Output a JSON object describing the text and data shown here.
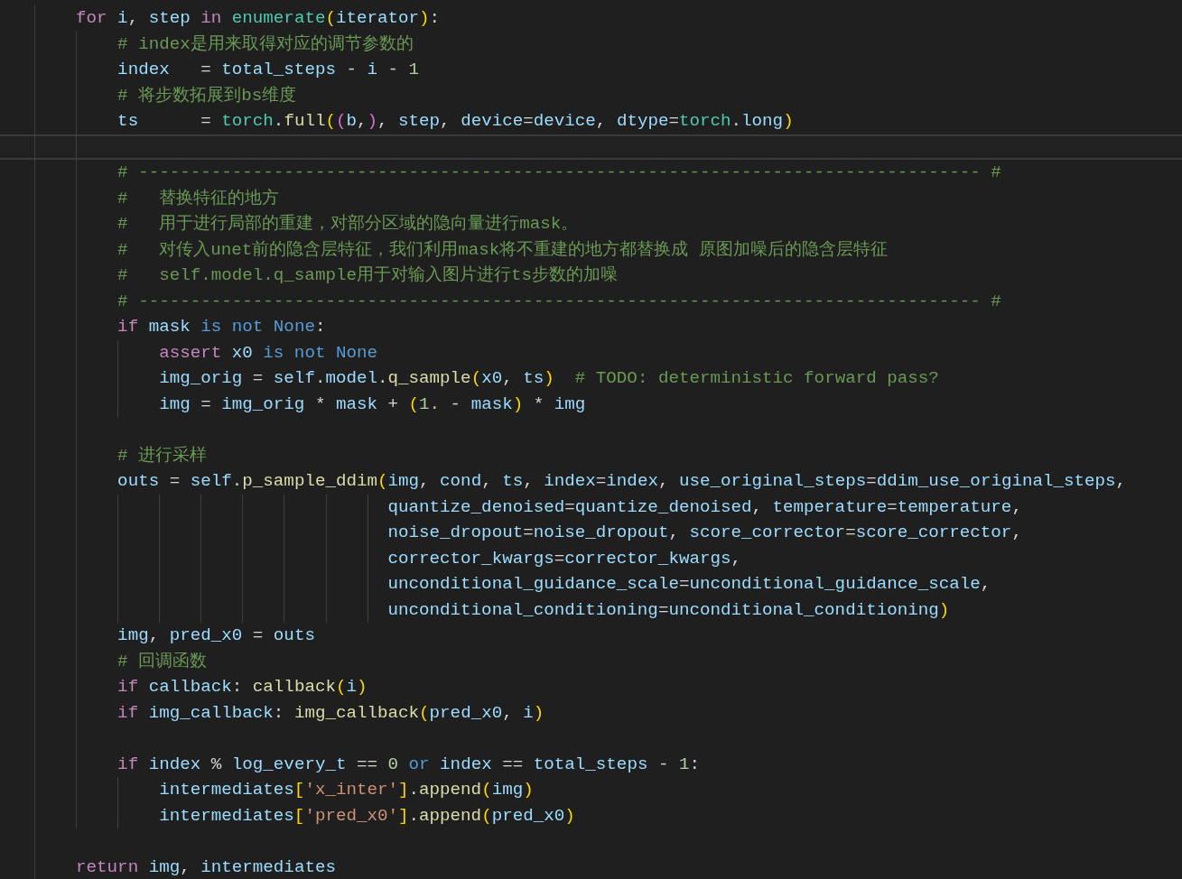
{
  "editor": {
    "lines": [
      {
        "current": false,
        "tokens": [
          {
            "text": "    for",
            "kind": "keyword"
          },
          {
            "text": " i",
            "kind": "variable"
          },
          {
            "text": ", ",
            "kind": "plain"
          },
          {
            "text": "step ",
            "kind": "variable"
          },
          {
            "text": "in ",
            "kind": "keyword"
          },
          {
            "text": "enumerate",
            "kind": "type"
          },
          {
            "text": "(",
            "kind": "bracket1"
          },
          {
            "text": "iterator",
            "kind": "variable"
          },
          {
            "text": ")",
            "kind": "bracket1"
          },
          {
            "text": ":",
            "kind": "plain"
          }
        ]
      },
      {
        "current": false,
        "tokens": [
          {
            "text": "        # index是用来取得对应的调节参数的",
            "kind": "comment"
          }
        ]
      },
      {
        "current": false,
        "tokens": [
          {
            "text": "        index",
            "kind": "variable"
          },
          {
            "text": "   = ",
            "kind": "plain"
          },
          {
            "text": "total_steps",
            "kind": "variable"
          },
          {
            "text": " - ",
            "kind": "plain"
          },
          {
            "text": "i",
            "kind": "variable"
          },
          {
            "text": " - ",
            "kind": "plain"
          },
          {
            "text": "1",
            "kind": "number"
          }
        ]
      },
      {
        "current": false,
        "tokens": [
          {
            "text": "        # 将步数拓展到bs维度",
            "kind": "comment"
          }
        ]
      },
      {
        "current": false,
        "tokens": [
          {
            "text": "        ts",
            "kind": "variable"
          },
          {
            "text": "      = ",
            "kind": "plain"
          },
          {
            "text": "torch",
            "kind": "type"
          },
          {
            "text": ".",
            "kind": "plain"
          },
          {
            "text": "full",
            "kind": "function"
          },
          {
            "text": "(",
            "kind": "bracket1"
          },
          {
            "text": "(",
            "kind": "bracket2"
          },
          {
            "text": "b",
            "kind": "variable"
          },
          {
            "text": ",",
            "kind": "plain"
          },
          {
            "text": ")",
            "kind": "bracket2"
          },
          {
            "text": ", ",
            "kind": "plain"
          },
          {
            "text": "step",
            "kind": "variable"
          },
          {
            "text": ", ",
            "kind": "plain"
          },
          {
            "text": "device",
            "kind": "variable"
          },
          {
            "text": "=",
            "kind": "plain"
          },
          {
            "text": "device",
            "kind": "variable"
          },
          {
            "text": ", ",
            "kind": "plain"
          },
          {
            "text": "dtype",
            "kind": "variable"
          },
          {
            "text": "=",
            "kind": "plain"
          },
          {
            "text": "torch",
            "kind": "type"
          },
          {
            "text": ".",
            "kind": "plain"
          },
          {
            "text": "long",
            "kind": "variable"
          },
          {
            "text": ")",
            "kind": "bracket1"
          }
        ]
      },
      {
        "current": true
      },
      {
        "current": false,
        "tokens": [
          {
            "text": "        # --------------------------------------------------------------------------------- #",
            "kind": "comment"
          }
        ]
      },
      {
        "current": false,
        "tokens": [
          {
            "text": "        #   替换特征的地方",
            "kind": "comment"
          }
        ]
      },
      {
        "current": false,
        "tokens": [
          {
            "text": "        #   用于进行局部的重建，对部分区域的隐向量进行mask。",
            "kind": "comment"
          }
        ]
      },
      {
        "current": false,
        "tokens": [
          {
            "text": "        #   对传入unet前的隐含层特征，我们利用mask将不重建的地方都替换成 原图加噪后的隐含层特征",
            "kind": "comment"
          }
        ]
      },
      {
        "current": false,
        "tokens": [
          {
            "text": "        #   self.model.q_sample用于对输入图片进行ts步数的加噪",
            "kind": "comment"
          }
        ]
      },
      {
        "current": false,
        "tokens": [
          {
            "text": "        # --------------------------------------------------------------------------------- #",
            "kind": "comment"
          }
        ]
      },
      {
        "current": false,
        "tokens": [
          {
            "text": "        if ",
            "kind": "keyword"
          },
          {
            "text": "mask ",
            "kind": "variable"
          },
          {
            "text": "is not None",
            "kind": "keyword2"
          },
          {
            "text": ":",
            "kind": "plain"
          }
        ]
      },
      {
        "current": false,
        "tokens": [
          {
            "text": "            assert ",
            "kind": "keyword"
          },
          {
            "text": "x0 ",
            "kind": "variable"
          },
          {
            "text": "is not None",
            "kind": "keyword2"
          }
        ]
      },
      {
        "current": false,
        "tokens": [
          {
            "text": "            img_orig",
            "kind": "variable"
          },
          {
            "text": " = ",
            "kind": "plain"
          },
          {
            "text": "self",
            "kind": "variable"
          },
          {
            "text": ".",
            "kind": "plain"
          },
          {
            "text": "model",
            "kind": "variable"
          },
          {
            "text": ".",
            "kind": "plain"
          },
          {
            "text": "q_sample",
            "kind": "function"
          },
          {
            "text": "(",
            "kind": "bracket1"
          },
          {
            "text": "x0",
            "kind": "variable"
          },
          {
            "text": ", ",
            "kind": "plain"
          },
          {
            "text": "ts",
            "kind": "variable"
          },
          {
            "text": ")",
            "kind": "bracket1"
          },
          {
            "text": "  # TODO: deterministic forward pass?",
            "kind": "comment"
          }
        ]
      },
      {
        "current": false,
        "tokens": [
          {
            "text": "            img",
            "kind": "variable"
          },
          {
            "text": " = ",
            "kind": "plain"
          },
          {
            "text": "img_orig",
            "kind": "variable"
          },
          {
            "text": " * ",
            "kind": "plain"
          },
          {
            "text": "mask",
            "kind": "variable"
          },
          {
            "text": " + ",
            "kind": "plain"
          },
          {
            "text": "(",
            "kind": "bracket1"
          },
          {
            "text": "1.",
            "kind": "number"
          },
          {
            "text": " - ",
            "kind": "plain"
          },
          {
            "text": "mask",
            "kind": "variable"
          },
          {
            "text": ")",
            "kind": "bracket1"
          },
          {
            "text": " * ",
            "kind": "plain"
          },
          {
            "text": "img",
            "kind": "variable"
          }
        ]
      },
      {
        "current": false
      },
      {
        "current": false,
        "tokens": [
          {
            "text": "        # 进行采样",
            "kind": "comment"
          }
        ]
      },
      {
        "current": false,
        "tokens": [
          {
            "text": "        outs",
            "kind": "variable"
          },
          {
            "text": " = ",
            "kind": "plain"
          },
          {
            "text": "self",
            "kind": "variable"
          },
          {
            "text": ".",
            "kind": "plain"
          },
          {
            "text": "p_sample_ddim",
            "kind": "function"
          },
          {
            "text": "(",
            "kind": "bracket1"
          },
          {
            "text": "img",
            "kind": "variable"
          },
          {
            "text": ", ",
            "kind": "plain"
          },
          {
            "text": "cond",
            "kind": "variable"
          },
          {
            "text": ", ",
            "kind": "plain"
          },
          {
            "text": "ts",
            "kind": "variable"
          },
          {
            "text": ", ",
            "kind": "plain"
          },
          {
            "text": "index",
            "kind": "variable"
          },
          {
            "text": "=",
            "kind": "plain"
          },
          {
            "text": "index",
            "kind": "variable"
          },
          {
            "text": ", ",
            "kind": "plain"
          },
          {
            "text": "use_original_steps",
            "kind": "variable"
          },
          {
            "text": "=",
            "kind": "plain"
          },
          {
            "text": "ddim_use_original_steps",
            "kind": "variable"
          },
          {
            "text": ",",
            "kind": "plain"
          }
        ]
      },
      {
        "current": false,
        "tokens": [
          {
            "text": "                                  quantize_denoised",
            "kind": "variable"
          },
          {
            "text": "=",
            "kind": "plain"
          },
          {
            "text": "quantize_denoised",
            "kind": "variable"
          },
          {
            "text": ", ",
            "kind": "plain"
          },
          {
            "text": "temperature",
            "kind": "variable"
          },
          {
            "text": "=",
            "kind": "plain"
          },
          {
            "text": "temperature",
            "kind": "variable"
          },
          {
            "text": ",",
            "kind": "plain"
          }
        ]
      },
      {
        "current": false,
        "tokens": [
          {
            "text": "                                  noise_dropout",
            "kind": "variable"
          },
          {
            "text": "=",
            "kind": "plain"
          },
          {
            "text": "noise_dropout",
            "kind": "variable"
          },
          {
            "text": ", ",
            "kind": "plain"
          },
          {
            "text": "score_corrector",
            "kind": "variable"
          },
          {
            "text": "=",
            "kind": "plain"
          },
          {
            "text": "score_corrector",
            "kind": "variable"
          },
          {
            "text": ",",
            "kind": "plain"
          }
        ]
      },
      {
        "current": false,
        "tokens": [
          {
            "text": "                                  corrector_kwargs",
            "kind": "variable"
          },
          {
            "text": "=",
            "kind": "plain"
          },
          {
            "text": "corrector_kwargs",
            "kind": "variable"
          },
          {
            "text": ",",
            "kind": "plain"
          }
        ]
      },
      {
        "current": false,
        "tokens": [
          {
            "text": "                                  unconditional_guidance_scale",
            "kind": "variable"
          },
          {
            "text": "=",
            "kind": "plain"
          },
          {
            "text": "unconditional_guidance_scale",
            "kind": "variable"
          },
          {
            "text": ",",
            "kind": "plain"
          }
        ]
      },
      {
        "current": false,
        "tokens": [
          {
            "text": "                                  unconditional_conditioning",
            "kind": "variable"
          },
          {
            "text": "=",
            "kind": "plain"
          },
          {
            "text": "unconditional_conditioning",
            "kind": "variable"
          },
          {
            "text": ")",
            "kind": "bracket1"
          }
        ]
      },
      {
        "current": false,
        "tokens": [
          {
            "text": "        img",
            "kind": "variable"
          },
          {
            "text": ", ",
            "kind": "plain"
          },
          {
            "text": "pred_x0",
            "kind": "variable"
          },
          {
            "text": " = ",
            "kind": "plain"
          },
          {
            "text": "outs",
            "kind": "variable"
          }
        ]
      },
      {
        "current": false,
        "tokens": [
          {
            "text": "        # 回调函数",
            "kind": "comment"
          }
        ]
      },
      {
        "current": false,
        "tokens": [
          {
            "text": "        if ",
            "kind": "keyword"
          },
          {
            "text": "callback",
            "kind": "variable"
          },
          {
            "text": ": ",
            "kind": "plain"
          },
          {
            "text": "callback",
            "kind": "function"
          },
          {
            "text": "(",
            "kind": "bracket1"
          },
          {
            "text": "i",
            "kind": "variable"
          },
          {
            "text": ")",
            "kind": "bracket1"
          }
        ]
      },
      {
        "current": false,
        "tokens": [
          {
            "text": "        if ",
            "kind": "keyword"
          },
          {
            "text": "img_callback",
            "kind": "variable"
          },
          {
            "text": ": ",
            "kind": "plain"
          },
          {
            "text": "img_callback",
            "kind": "function"
          },
          {
            "text": "(",
            "kind": "bracket1"
          },
          {
            "text": "pred_x0",
            "kind": "variable"
          },
          {
            "text": ", ",
            "kind": "plain"
          },
          {
            "text": "i",
            "kind": "variable"
          },
          {
            "text": ")",
            "kind": "bracket1"
          }
        ]
      },
      {
        "current": false
      },
      {
        "current": false,
        "tokens": [
          {
            "text": "        if ",
            "kind": "keyword"
          },
          {
            "text": "index",
            "kind": "variable"
          },
          {
            "text": " % ",
            "kind": "plain"
          },
          {
            "text": "log_every_t",
            "kind": "variable"
          },
          {
            "text": " == ",
            "kind": "plain"
          },
          {
            "text": "0 ",
            "kind": "number"
          },
          {
            "text": "or ",
            "kind": "keyword2"
          },
          {
            "text": "index",
            "kind": "variable"
          },
          {
            "text": " == ",
            "kind": "plain"
          },
          {
            "text": "total_steps",
            "kind": "variable"
          },
          {
            "text": " - ",
            "kind": "plain"
          },
          {
            "text": "1",
            "kind": "number"
          },
          {
            "text": ":",
            "kind": "plain"
          }
        ]
      },
      {
        "current": false,
        "tokens": [
          {
            "text": "            intermediates",
            "kind": "variable"
          },
          {
            "text": "[",
            "kind": "bracket1"
          },
          {
            "text": "'x_inter'",
            "kind": "string"
          },
          {
            "text": "]",
            "kind": "bracket1"
          },
          {
            "text": ".",
            "kind": "plain"
          },
          {
            "text": "append",
            "kind": "function"
          },
          {
            "text": "(",
            "kind": "bracket1"
          },
          {
            "text": "img",
            "kind": "variable"
          },
          {
            "text": ")",
            "kind": "bracket1"
          }
        ]
      },
      {
        "current": false,
        "tokens": [
          {
            "text": "            intermediates",
            "kind": "variable"
          },
          {
            "text": "[",
            "kind": "bracket1"
          },
          {
            "text": "'pred_x0'",
            "kind": "string"
          },
          {
            "text": "]",
            "kind": "bracket1"
          },
          {
            "text": ".",
            "kind": "plain"
          },
          {
            "text": "append",
            "kind": "function"
          },
          {
            "text": "(",
            "kind": "bracket1"
          },
          {
            "text": "pred_x0",
            "kind": "variable"
          },
          {
            "text": ")",
            "kind": "bracket1"
          }
        ]
      },
      {
        "current": false
      },
      {
        "current": false,
        "tokens": [
          {
            "text": "    return ",
            "kind": "keyword"
          },
          {
            "text": "img",
            "kind": "variable"
          },
          {
            "text": ", ",
            "kind": "plain"
          },
          {
            "text": "intermediates",
            "kind": "variable"
          }
        ]
      }
    ]
  }
}
